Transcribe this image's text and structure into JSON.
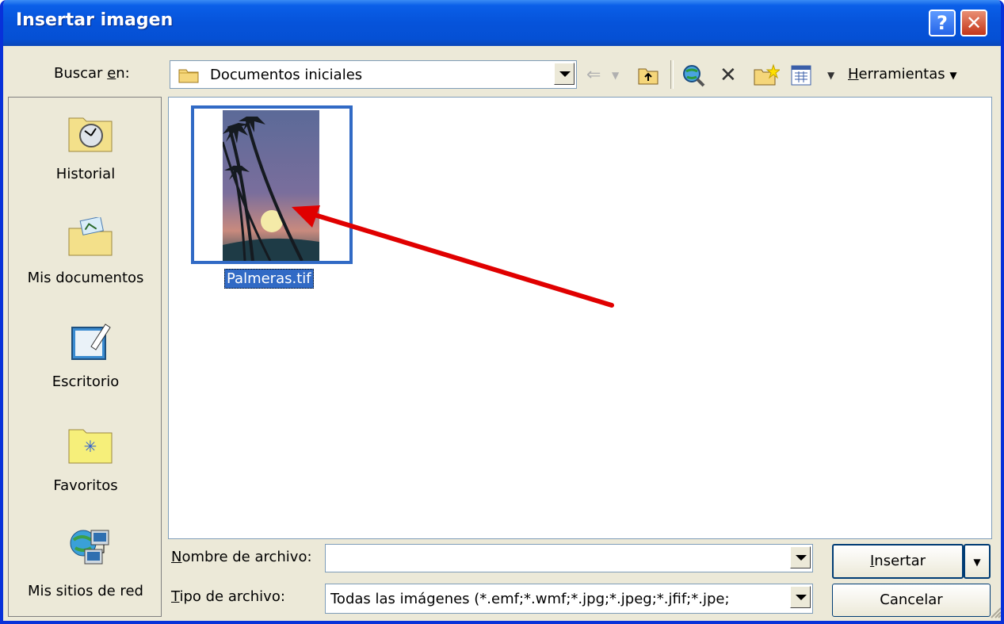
{
  "window": {
    "title": "Insertar imagen"
  },
  "titlebar_buttons": {
    "help": "?",
    "close": "✕"
  },
  "toolbar": {
    "look_in_label_pre": "Buscar ",
    "look_in_label_u": "e",
    "look_in_label_post": "n:",
    "look_in_value": "Documentos iniciales",
    "tools_label_u": "H",
    "tools_label_rest": "erramientas"
  },
  "places": [
    {
      "label": "Historial",
      "icon": "history-folder-icon"
    },
    {
      "label": "Mis documentos",
      "icon": "my-documents-icon"
    },
    {
      "label": "Escritorio",
      "icon": "desktop-icon"
    },
    {
      "label": "Favoritos",
      "icon": "favorites-folder-icon"
    },
    {
      "label": "Mis sitios de red",
      "icon": "network-places-icon"
    }
  ],
  "files": [
    {
      "name": "Palmeras.tif",
      "selected": true
    }
  ],
  "form": {
    "filename_label_u": "N",
    "filename_label_rest": "ombre de archivo:",
    "filename_value": "",
    "filetype_label_u": "T",
    "filetype_label_rest": "ipo de archivo:",
    "filetype_value": "Todas las imágenes (*.emf;*.wmf;*.jpg;*.jpeg;*.jfif;*.jpe;"
  },
  "buttons": {
    "insert_u": "I",
    "insert_rest": "nsertar",
    "cancel": "Cancelar"
  },
  "colors": {
    "titlebar": "#0553d7",
    "selection": "#316ac5",
    "face": "#ece9d8",
    "arrow": "#e00000"
  }
}
